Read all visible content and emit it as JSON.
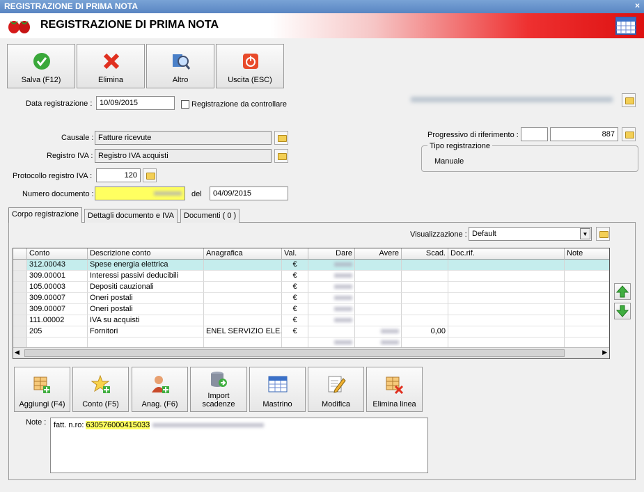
{
  "window": {
    "title": "REGISTRAZIONE DI PRIMA NOTA",
    "banner_title": "REGISTRAZIONE DI PRIMA NOTA"
  },
  "toolbar": {
    "save": "Salva (F12)",
    "delete": "Elimina",
    "other": "Altro",
    "exit": "Uscita (ESC)"
  },
  "form": {
    "data_reg_label": "Data registrazione :",
    "data_reg": "10/09/2015",
    "check_label": "Registrazione da controllare",
    "causale_label": "Causale :",
    "causale": "Fatture ricevute",
    "registro_label": "Registro IVA :",
    "registro": "Registro IVA acquisti",
    "protocollo_label": "Protocollo registro IVA :",
    "protocollo": "120",
    "numdoc_label": "Numero documento :",
    "del_label": "del",
    "del_date": "04/09/2015",
    "progressivo_label": "Progressivo di riferimento :",
    "progressivo": "887",
    "tipo_label": "Tipo registrazione",
    "tipo": "Manuale"
  },
  "tabs": [
    "Corpo registrazione",
    "Dettagli documento e IVA",
    "Documenti ( 0 )"
  ],
  "visualizzazione": {
    "label": "Visualizzazione :",
    "value": "Default"
  },
  "grid": {
    "columns": [
      "Conto",
      "Descrizione conto",
      "Anagrafica",
      "Val.",
      "Dare",
      "Avere",
      "Scad.",
      "Doc.rif.",
      "Note"
    ],
    "rows": [
      {
        "conto": "312.00043",
        "desc": "Spese energia elettrica",
        "anag": "",
        "val": "€",
        "scad": ""
      },
      {
        "conto": "309.00001",
        "desc": "Interessi passivi deducibili",
        "anag": "",
        "val": "€",
        "scad": ""
      },
      {
        "conto": "105.00003",
        "desc": "Depositi cauzionali",
        "anag": "",
        "val": "€",
        "scad": ""
      },
      {
        "conto": "309.00007",
        "desc": "Oneri postali",
        "anag": "",
        "val": "€",
        "scad": ""
      },
      {
        "conto": "309.00007",
        "desc": "Oneri postali",
        "anag": "",
        "val": "€",
        "scad": ""
      },
      {
        "conto": "111.00002",
        "desc": "IVA su acquisti",
        "anag": "",
        "val": "€",
        "scad": ""
      },
      {
        "conto": "205",
        "desc": "Fornitori",
        "anag": "ENEL SERVIZIO ELE...",
        "val": "€",
        "scad": "0,00"
      }
    ]
  },
  "bottom_toolbar": {
    "aggiungi": "Aggiungi (F4)",
    "conto": "Conto (F5)",
    "anag": "Anag. (F6)",
    "import1": "Import",
    "import2": "scadenze",
    "mastrino": "Mastrino",
    "modifica": "Modifica",
    "elimina_linea": "Elimina linea"
  },
  "note": {
    "label": "Note :",
    "prefix": "fatt. n.ro: ",
    "number": "630576000415033"
  },
  "colors": {
    "highlight": "#ffff60",
    "selected_row": "#c5eded",
    "banner_red": "#e02020"
  }
}
